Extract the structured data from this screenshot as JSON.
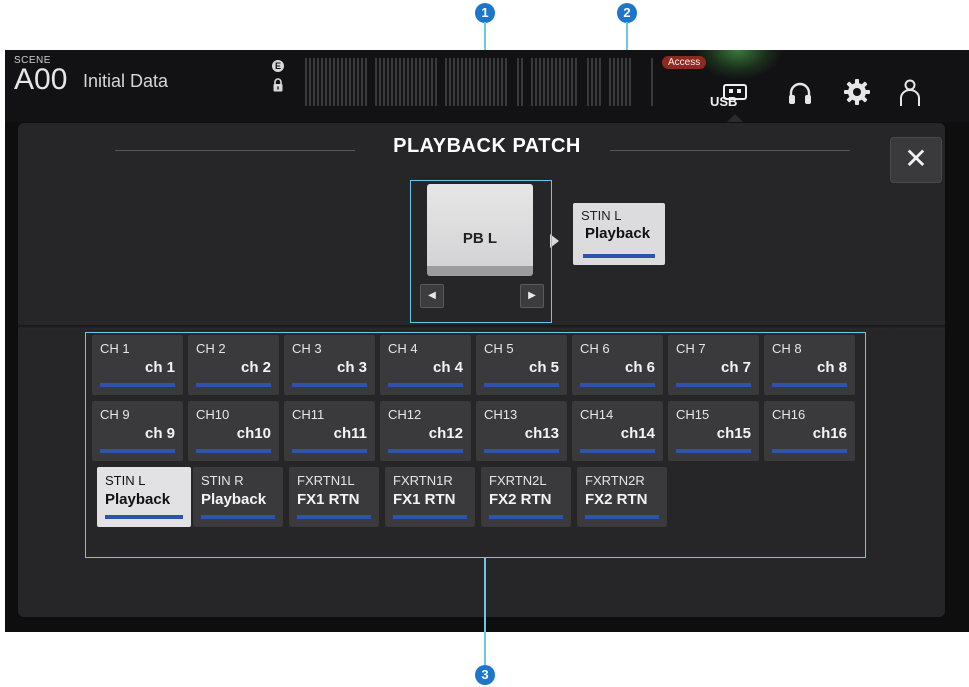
{
  "callouts": [
    "1",
    "2",
    "3"
  ],
  "header": {
    "scene_label": "SCENE",
    "scene_number": "A00",
    "scene_name": "Initial Data",
    "e_badge": "E",
    "access_badge": "Access",
    "usb_label": "USB"
  },
  "dialog": {
    "title": "PLAYBACK PATCH",
    "close_symbol": "✕",
    "selected_source": "PB L",
    "prev_symbol": "◀",
    "next_symbol": "▶",
    "destination": {
      "top": "STIN L",
      "bottom": "Playback"
    }
  },
  "patch_grid": {
    "cells": [
      {
        "top": "CH 1",
        "bottom": "ch 1"
      },
      {
        "top": "CH 2",
        "bottom": "ch 2"
      },
      {
        "top": "CH 3",
        "bottom": "ch 3"
      },
      {
        "top": "CH 4",
        "bottom": "ch 4"
      },
      {
        "top": "CH 5",
        "bottom": "ch 5"
      },
      {
        "top": "CH 6",
        "bottom": "ch 6"
      },
      {
        "top": "CH 7",
        "bottom": "ch 7"
      },
      {
        "top": "CH 8",
        "bottom": "ch 8"
      },
      {
        "top": "CH 9",
        "bottom": "ch 9"
      },
      {
        "top": "CH10",
        "bottom": "ch10"
      },
      {
        "top": "CH11",
        "bottom": "ch11"
      },
      {
        "top": "CH12",
        "bottom": "ch12"
      },
      {
        "top": "CH13",
        "bottom": "ch13"
      },
      {
        "top": "CH14",
        "bottom": "ch14"
      },
      {
        "top": "CH15",
        "bottom": "ch15"
      },
      {
        "top": "CH16",
        "bottom": "ch16"
      },
      {
        "top": "STIN L",
        "bottom": "Playback"
      },
      {
        "top": "STIN R",
        "bottom": "Playback"
      },
      {
        "top": "FXRTN1L",
        "bottom": "FX1 RTN"
      },
      {
        "top": "FXRTN1R",
        "bottom": "FX1 RTN"
      },
      {
        "top": "FXRTN2L",
        "bottom": "FX2 RTN"
      },
      {
        "top": "FXRTN2R",
        "bottom": "FX2 RTN"
      }
    ],
    "selected_index": 16
  },
  "icons": [
    "lock-icon",
    "usb-memory-icon",
    "headphones-icon",
    "gear-icon",
    "user-icon"
  ],
  "colors": {
    "accent_blue": "#2c54a8",
    "highlight_outline": "#6dc6ec",
    "callout_blue": "#1d76c9",
    "access_red": "#8e2a1d",
    "usb_glow": "#5ad25a"
  }
}
